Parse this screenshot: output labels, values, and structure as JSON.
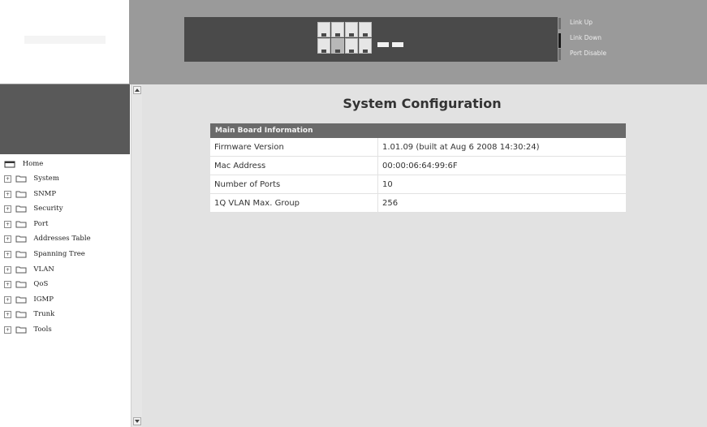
{
  "banner": {
    "legend": [
      "Link Up",
      "Link Down",
      "Port Disable"
    ]
  },
  "sidebar": {
    "items": [
      {
        "label": "Home",
        "expandable": false
      },
      {
        "label": "System",
        "expandable": true
      },
      {
        "label": "SNMP",
        "expandable": true
      },
      {
        "label": "Security",
        "expandable": true
      },
      {
        "label": "Port",
        "expandable": true
      },
      {
        "label": "Addresses Table",
        "expandable": true
      },
      {
        "label": "Spanning Tree",
        "expandable": true
      },
      {
        "label": "VLAN",
        "expandable": true
      },
      {
        "label": "QoS",
        "expandable": true
      },
      {
        "label": "IGMP",
        "expandable": true
      },
      {
        "label": "Trunk",
        "expandable": true
      },
      {
        "label": "Tools",
        "expandable": true
      }
    ]
  },
  "main": {
    "title": "System Configuration",
    "table": {
      "header": "Main Board Information",
      "rows": [
        {
          "label": "Firmware Version",
          "value": "1.01.09 (built at Aug 6 2008 14:30:24)"
        },
        {
          "label": "Mac Address",
          "value": "00:00:06:64:99:6F"
        },
        {
          "label": "Number of Ports",
          "value": "10"
        },
        {
          "label": "1Q VLAN Max. Group",
          "value": "256"
        }
      ]
    }
  },
  "icons": {
    "home": "home-icon",
    "folder": "folder-icon",
    "expand": "plus-box-icon",
    "scroll_up": "arrow-up-icon",
    "scroll_down": "arrow-down-icon"
  },
  "colors": {
    "banner": "#9a9a9a",
    "switch_panel": "#4a4a4a",
    "table_header": "#6a6a6a",
    "main_bg": "#e2e2e2"
  }
}
